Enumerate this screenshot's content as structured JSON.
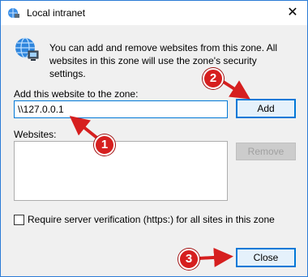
{
  "window": {
    "title": "Local intranet",
    "close_glyph": "✕"
  },
  "info_text": "You can add and remove websites from this zone. All websites in this zone will use the zone's security settings.",
  "add_section": {
    "label": "Add this website to the zone:",
    "value": "\\\\127.0.0.1",
    "add_button": "Add"
  },
  "websites": {
    "label": "Websites:",
    "items": [],
    "remove_button": "Remove"
  },
  "require_verification": {
    "label": "Require server verification (https:) for all sites in this zone",
    "checked": false
  },
  "close_button": "Close",
  "annotations": [
    {
      "number": "1"
    },
    {
      "number": "2"
    },
    {
      "number": "3"
    }
  ],
  "colors": {
    "accent": "#0078d7",
    "badge": "#d61f1f"
  }
}
